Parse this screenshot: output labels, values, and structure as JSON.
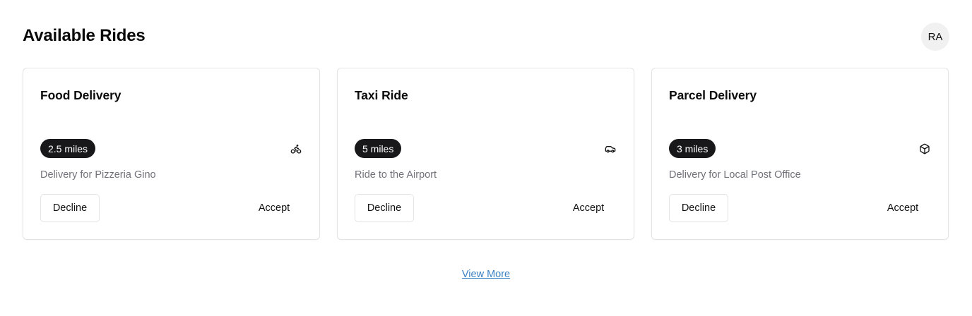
{
  "header": {
    "title": "Available Rides",
    "avatar_initials": "RA"
  },
  "rides": [
    {
      "title": "Food Delivery",
      "distance": "2.5 miles",
      "description": "Delivery for Pizzeria Gino",
      "icon": "bike-icon",
      "decline_label": "Decline",
      "accept_label": "Accept"
    },
    {
      "title": "Taxi Ride",
      "distance": "5 miles",
      "description": "Ride to the Airport",
      "icon": "car-icon",
      "decline_label": "Decline",
      "accept_label": "Accept"
    },
    {
      "title": "Parcel Delivery",
      "distance": "3 miles",
      "description": "Delivery for Local Post Office",
      "icon": "package-icon",
      "decline_label": "Decline",
      "accept_label": "Accept"
    }
  ],
  "footer": {
    "view_more_label": "View More"
  },
  "colors": {
    "badge_bg": "#18181b",
    "link": "#3b82c4",
    "muted_text": "#71717a",
    "border": "#e4e4e7"
  }
}
